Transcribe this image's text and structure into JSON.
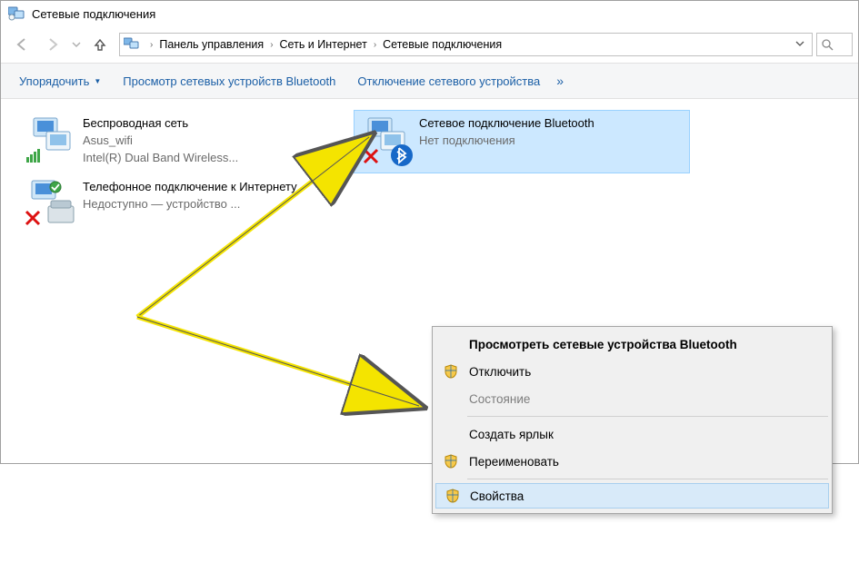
{
  "window": {
    "title": "Сетевые подключения"
  },
  "breadcrumb": {
    "items": [
      {
        "label": "Панель управления"
      },
      {
        "label": "Сеть и Интернет"
      },
      {
        "label": "Сетевые подключения"
      }
    ]
  },
  "toolbar": {
    "organize": "Упорядочить",
    "view_bt": "Просмотр сетевых устройств Bluetooth",
    "disable": "Отключение сетевого устройства",
    "overflow": "»"
  },
  "connections": [
    {
      "name": "Беспроводная сеть",
      "sub1": "Asus_wifi",
      "sub2": "Intel(R) Dual Band Wireless...",
      "iconKind": "wifi",
      "selected": false
    },
    {
      "name": "Сетевое подключение Bluetooth",
      "sub1": "Нет подключения",
      "sub2": "",
      "iconKind": "bt",
      "selected": true
    },
    {
      "name": "Телефонное подключение к Интернету",
      "sub1": "Недоступно — устройство ...",
      "sub2": "",
      "iconKind": "phone",
      "selected": false
    }
  ],
  "contextMenu": {
    "header": "Просмотреть сетевые устройства Bluetooth",
    "disable": "Отключить",
    "status": "Состояние",
    "shortcut": "Создать ярлык",
    "rename": "Переименовать",
    "props": "Свойства"
  }
}
